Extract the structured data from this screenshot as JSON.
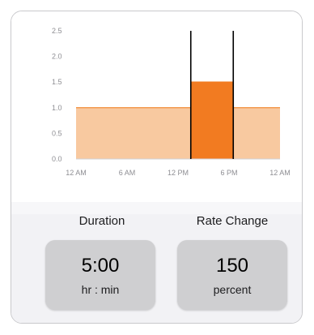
{
  "chart_data": {
    "type": "area",
    "y_ticks": [
      "2.5",
      "2.0",
      "1.5",
      "1.0",
      "0.5",
      "0.0"
    ],
    "x_tick_labels": [
      "12 AM",
      "6 AM",
      "12 PM",
      "6 PM",
      "12 AM"
    ],
    "xlim_hours": [
      0,
      24
    ],
    "ylim": [
      0,
      2.5
    ],
    "series": [
      {
        "segments": [
          {
            "start_hour": 0,
            "end_hour": 13.5,
            "value": 1.0
          },
          {
            "start_hour": 13.5,
            "end_hour": 18.5,
            "value": 1.5
          },
          {
            "start_hour": 18.5,
            "end_hour": 24,
            "value": 1.0
          }
        ]
      }
    ],
    "highlight_range_hours": [
      13.5,
      18.5
    ],
    "colors": {
      "base_fill": "#f8c9a0",
      "base_line": "#f39a4f",
      "highlight_fill": "#f27b21",
      "marker_line": "#000000",
      "tick_text": "#8e8e93",
      "axis_line": "#d1d1d6"
    },
    "grid": false
  },
  "settings": {
    "duration_label": "Duration",
    "duration_value": "5:00",
    "duration_unit": "hr : min",
    "rate_label": "Rate Change",
    "rate_value": "150",
    "rate_unit": "percent"
  },
  "colors": {
    "tile_bg": "#cfcfd1",
    "panel_bg": "#f2f2f5"
  }
}
